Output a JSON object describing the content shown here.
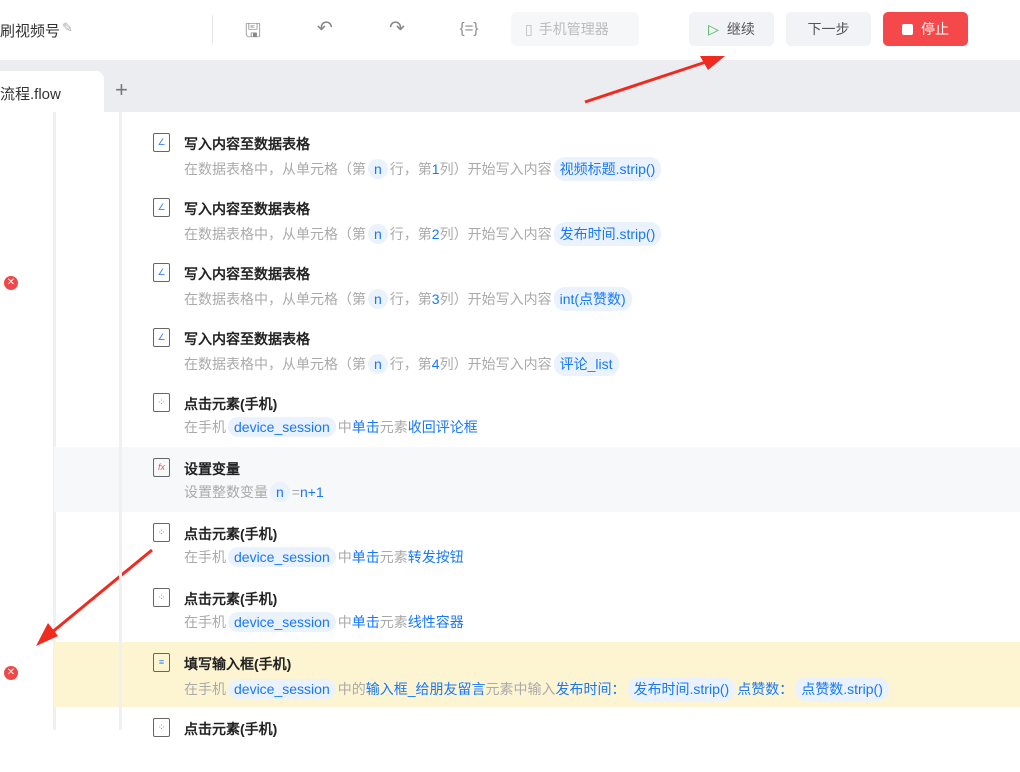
{
  "header": {
    "title": "刷视频号",
    "phone_manager": "手机管理器",
    "continue": "继续",
    "next_step": "下一步",
    "stop": "停止"
  },
  "tabs": {
    "active": "流程.flow",
    "add": "+"
  },
  "colors": {
    "accent": "#1677ff",
    "stop": "#f5484a",
    "highlight": "#fdf4d2"
  },
  "rows": [
    {
      "title": "写入内容至数据表格",
      "icon": "table-write-icon",
      "desc": [
        {
          "t": "在数据表格中，从单元格（第",
          "k": "g"
        },
        {
          "t": "n",
          "k": "p"
        },
        {
          "t": "行，第",
          "k": "g"
        },
        {
          "t": "1",
          "k": "b"
        },
        {
          "t": "列）开始写入内容",
          "k": "g"
        },
        {
          "t": "视频标题.strip()",
          "k": "p"
        }
      ]
    },
    {
      "title": "写入内容至数据表格",
      "icon": "table-write-icon",
      "desc": [
        {
          "t": "在数据表格中，从单元格（第",
          "k": "g"
        },
        {
          "t": "n",
          "k": "p"
        },
        {
          "t": "行，第",
          "k": "g"
        },
        {
          "t": "2",
          "k": "b"
        },
        {
          "t": "列）开始写入内容",
          "k": "g"
        },
        {
          "t": "发布时间.strip()",
          "k": "p"
        }
      ]
    },
    {
      "title": "写入内容至数据表格",
      "icon": "table-write-icon",
      "error": true,
      "desc": [
        {
          "t": "在数据表格中，从单元格（第",
          "k": "g"
        },
        {
          "t": "n",
          "k": "p"
        },
        {
          "t": "行，第",
          "k": "g"
        },
        {
          "t": "3",
          "k": "b"
        },
        {
          "t": "列）开始写入内容",
          "k": "g"
        },
        {
          "t": "int(点赞数)",
          "k": "p"
        }
      ]
    },
    {
      "title": "写入内容至数据表格",
      "icon": "table-write-icon",
      "desc": [
        {
          "t": "在数据表格中，从单元格（第",
          "k": "g"
        },
        {
          "t": "n",
          "k": "p"
        },
        {
          "t": "行，第",
          "k": "g"
        },
        {
          "t": "4",
          "k": "b"
        },
        {
          "t": "列）开始写入内容",
          "k": "g"
        },
        {
          "t": "评论_list",
          "k": "p"
        }
      ]
    },
    {
      "title": "点击元素(手机)",
      "icon": "phone-click-icon",
      "desc": [
        {
          "t": "在手机",
          "k": "g"
        },
        {
          "t": "device_session",
          "k": "p"
        },
        {
          "t": "中",
          "k": "g"
        },
        {
          "t": "单击",
          "k": "b"
        },
        {
          "t": "元素",
          "k": "g"
        },
        {
          "t": "收回评论框",
          "k": "b"
        }
      ]
    },
    {
      "title": "设置变量",
      "icon": "variable-fx-icon",
      "alt": true,
      "desc": [
        {
          "t": "设置整数变量",
          "k": "g"
        },
        {
          "t": "n",
          "k": "p"
        },
        {
          "t": "=",
          "k": "g"
        },
        {
          "t": "n+1",
          "k": "b"
        }
      ]
    },
    {
      "title": "点击元素(手机)",
      "icon": "phone-click-icon",
      "desc": [
        {
          "t": "在手机",
          "k": "g"
        },
        {
          "t": "device_session",
          "k": "p"
        },
        {
          "t": "中",
          "k": "g"
        },
        {
          "t": "单击",
          "k": "b"
        },
        {
          "t": "元素",
          "k": "g"
        },
        {
          "t": "转发按钮",
          "k": "b"
        }
      ]
    },
    {
      "title": "点击元素(手机)",
      "icon": "phone-click-icon",
      "desc": [
        {
          "t": "在手机",
          "k": "g"
        },
        {
          "t": "device_session",
          "k": "p"
        },
        {
          "t": "中",
          "k": "g"
        },
        {
          "t": "单击",
          "k": "b"
        },
        {
          "t": "元素",
          "k": "g"
        },
        {
          "t": "线性容器",
          "k": "b"
        }
      ]
    },
    {
      "title": "填写输入框(手机)",
      "icon": "phone-input-icon",
      "hl": true,
      "error": true,
      "desc": [
        {
          "t": "在手机",
          "k": "g"
        },
        {
          "t": "device_session",
          "k": "p"
        },
        {
          "t": "中的",
          "k": "g"
        },
        {
          "t": "输入框_给朋友留言",
          "k": "b"
        },
        {
          "t": "元素中输入",
          "k": "g"
        },
        {
          "t": "发布时间：",
          "k": "b"
        },
        {
          "t": "发布时间.strip()",
          "k": "p"
        },
        {
          "t": "点赞数：",
          "k": "b"
        },
        {
          "t": "点赞数.strip()",
          "k": "p"
        }
      ]
    },
    {
      "title": "点击元素(手机)",
      "icon": "phone-click-icon",
      "desc": []
    }
  ]
}
